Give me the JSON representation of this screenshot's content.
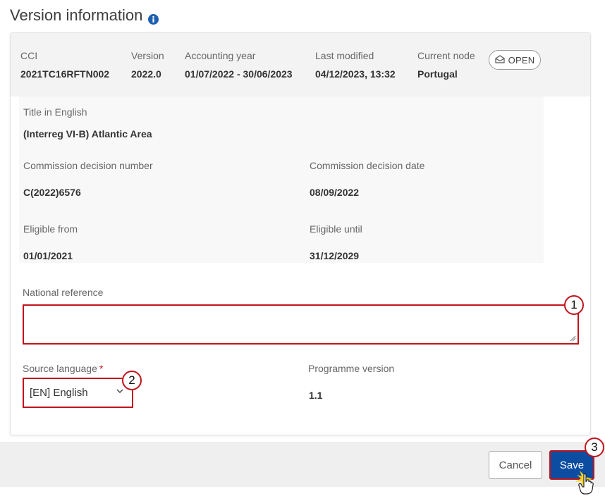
{
  "page": {
    "title": "Version information"
  },
  "header": {
    "cci_label": "CCI",
    "cci_value": "2021TC16RFTN002",
    "version_label": "Version",
    "version_value": "2022.0",
    "accounting_year_label": "Accounting year",
    "accounting_year_value": "01/07/2022 - 30/06/2023",
    "last_modified_label": "Last modified",
    "last_modified_value": "04/12/2023, 13:32",
    "current_node_label": "Current node",
    "current_node_value": "Portugal",
    "status_label": "OPEN"
  },
  "details": {
    "title_label": "Title in English",
    "title_value": "(Interreg VI-B) Atlantic Area",
    "decision_number_label": "Commission decision number",
    "decision_number_value": "C(2022)6576",
    "decision_date_label": "Commission decision date",
    "decision_date_value": "08/09/2022",
    "eligible_from_label": "Eligible from",
    "eligible_from_value": "01/01/2021",
    "eligible_until_label": "Eligible until",
    "eligible_until_value": "31/12/2029"
  },
  "form": {
    "national_reference_label": "National reference",
    "national_reference_value": "",
    "source_language_label": "Source language",
    "required_mark": "*",
    "source_language_value": "[EN] English",
    "programme_version_label": "Programme version",
    "programme_version_value": "1.1"
  },
  "callouts": {
    "one": "1",
    "two": "2",
    "three": "3"
  },
  "footer": {
    "cancel_label": "Cancel",
    "save_label": "Save"
  },
  "colors": {
    "accent_red": "#c0141c",
    "primary_blue": "#0c4da2",
    "info_blue": "#1d5fb0",
    "header_band": "#f3f3f3"
  },
  "icons": {
    "info": "info-icon",
    "status": "envelope-open-icon",
    "dropdown": "chevron-down-icon",
    "cursor": "hand-pointer-icon"
  }
}
